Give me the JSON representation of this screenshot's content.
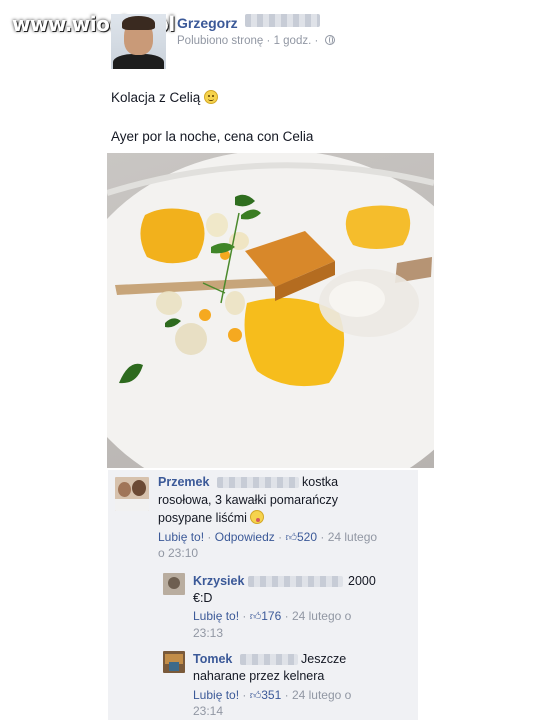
{
  "watermark": "www.wiocha.pl",
  "post": {
    "author": "Grzegorz",
    "meta_liked": "Polubiono stronę",
    "meta_sep": "·",
    "meta_time": "1 godz.",
    "text_pl": "Kolacja z Celią",
    "text_es": "Ayer por la noche, cena con Celia"
  },
  "comments": [
    {
      "author": "Przemek",
      "text_a": "kostka",
      "text_b": "rosołowa, 3 kawałki pomarańczy",
      "text_c": "posypane liśćmi",
      "like_label": "Lubię to!",
      "reply_label": "Odpowiedz",
      "sep": "·",
      "likes": "520",
      "date_a": "24 lutego",
      "date_b": "o 23:10"
    },
    {
      "author": "Krzysiek",
      "text_a": "2000",
      "text_b": "€:D",
      "like_label": "Lubię to!",
      "sep": "·",
      "likes": "176",
      "date_a": "24 lutego o",
      "date_b": "23:13"
    },
    {
      "author": "Tomek",
      "text_a": "Jeszcze",
      "text_b": "naharane przez kelnera",
      "like_label": "Lubię to!",
      "sep": "·",
      "likes": "351",
      "date_a": "24 lutego o",
      "date_b": "23:14"
    }
  ],
  "icons": {
    "globe": "globe-icon",
    "smile": "smiley-emoticon-icon",
    "tongue": "tongue-emoticon-icon",
    "thumb": "thumbs-up-icon"
  },
  "colors": {
    "link": "#3b5998",
    "muted": "#9197a3",
    "comment_bg": "#f0f1f4"
  }
}
